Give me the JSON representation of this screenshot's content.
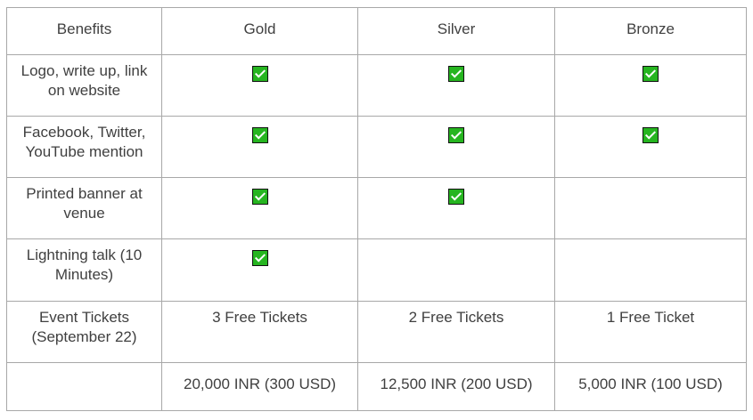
{
  "header": {
    "benefits": "Benefits",
    "gold": "Gold",
    "silver": "Silver",
    "bronze": "Bronze"
  },
  "rows": [
    {
      "label": "Logo, write up, link on website",
      "gold": true,
      "silver": true,
      "bronze": true
    },
    {
      "label": "Facebook, Twitter, YouTube mention",
      "gold": true,
      "silver": true,
      "bronze": true
    },
    {
      "label": "Printed banner at venue",
      "gold": true,
      "silver": true,
      "bronze": false
    },
    {
      "label": "Lightning talk (10 Minutes)",
      "gold": true,
      "silver": false,
      "bronze": false
    }
  ],
  "tickets": {
    "label": "Event Tickets (September 22)",
    "gold": "3 Free Tickets",
    "silver": "2 Free Tickets",
    "bronze": "1 Free Ticket"
  },
  "price": {
    "label": "",
    "gold": "20,000 INR (300 USD)",
    "silver": "12,500 INR (200 USD)",
    "bronze": "5,000 INR (100 USD)"
  },
  "icons": {
    "checkbox": "checked-box-icon",
    "check_color": "#26b520"
  }
}
